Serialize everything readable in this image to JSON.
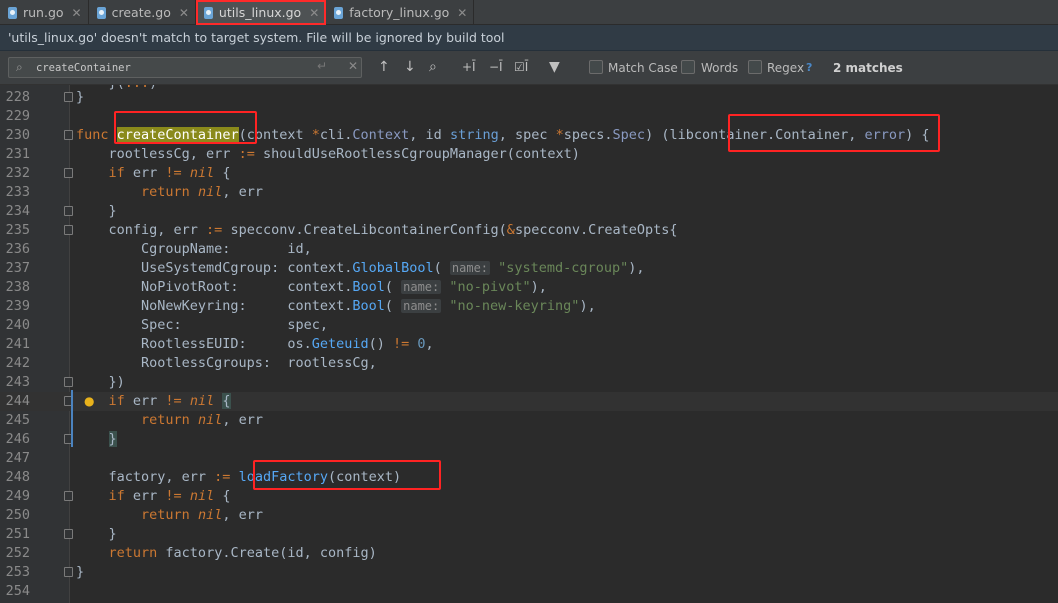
{
  "tabs": [
    {
      "label": "run.go",
      "active": false
    },
    {
      "label": "create.go",
      "active": false
    },
    {
      "label": "utils_linux.go",
      "active": true
    },
    {
      "label": "factory_linux.go",
      "active": false
    }
  ],
  "banner": {
    "text": "'utils_linux.go' doesn't match to target system. File will be ignored by build tool"
  },
  "find": {
    "query": "createContainer",
    "match_case": "Match Case",
    "words": "Words",
    "regex": "Regex",
    "help": "?",
    "matches": "2 matches"
  },
  "editor": {
    "line_numbers": [
      "228",
      "229",
      "230",
      "231",
      "232",
      "233",
      "234",
      "235",
      "236",
      "237",
      "238",
      "239",
      "240",
      "241",
      "242",
      "243",
      "244",
      "245",
      "246",
      "247",
      "248",
      "249",
      "250",
      "251",
      "252",
      "253",
      "254"
    ],
    "hint_name": "name:",
    "strings": {
      "systemd": "\"systemd-cgroup\"",
      "pivot": "\"no-pivot\"",
      "keyring": "\"no-new-keyring\""
    }
  }
}
